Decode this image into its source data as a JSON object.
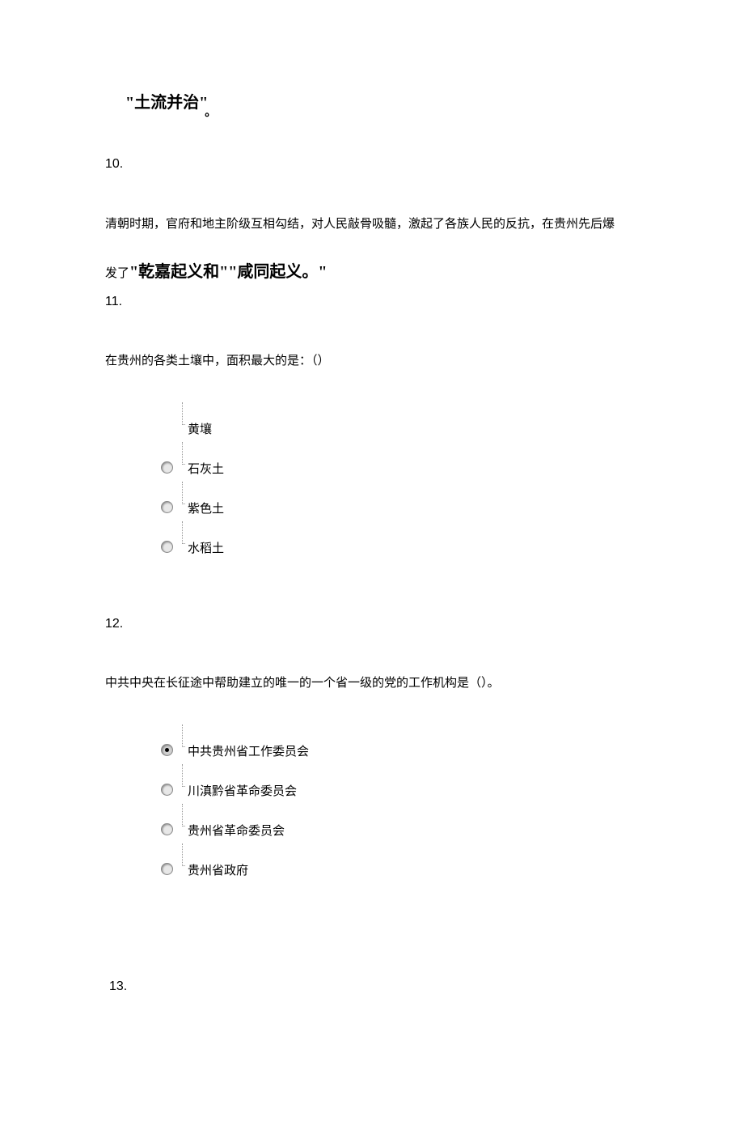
{
  "answer9": {
    "text": "\"土流并治\"",
    "period": "。"
  },
  "q10": {
    "number": "10.",
    "line1": "清朝时期，官府和地主阶级互相勾结，对人民敲骨吸髓，激起了各族人民的反抗，在贵州先后爆",
    "line2_prefix": "发了",
    "line2_bold": "\"乾嘉起义和\"\"咸同起义。\""
  },
  "q11": {
    "number": "11.",
    "text": "在贵州的各类土壤中，面积最大的是：（）",
    "options": [
      {
        "label": "黄壤",
        "selected": false,
        "has_radio": false
      },
      {
        "label": "石灰土",
        "selected": false,
        "has_radio": true
      },
      {
        "label": "紫色土",
        "selected": false,
        "has_radio": true
      },
      {
        "label": "水稻土",
        "selected": false,
        "has_radio": true
      }
    ]
  },
  "q12": {
    "number": "12.",
    "text": "中共中央在长征途中帮助建立的唯一的一个省一级的党的工作机构是（）。",
    "options": [
      {
        "label": "中共贵州省工作委员会",
        "selected": true,
        "has_radio": true
      },
      {
        "label": "川滇黔省革命委员会",
        "selected": false,
        "has_radio": true
      },
      {
        "label": "贵州省革命委员会",
        "selected": false,
        "has_radio": true
      },
      {
        "label": "贵州省政府",
        "selected": false,
        "has_radio": true
      }
    ]
  },
  "q13": {
    "number": "13."
  }
}
